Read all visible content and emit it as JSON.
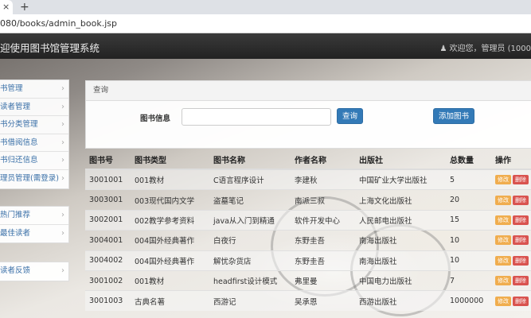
{
  "browser": {
    "tab_close": "×",
    "new_tab": "+",
    "url": "080/books/admin_book.jsp"
  },
  "navbar": {
    "title": "迎使用图书馆管理系统",
    "user_text": "欢迎您，管理员 (1000",
    "user_icon": "user-icon"
  },
  "sidebar": {
    "group1": [
      "书管理",
      "读者管理",
      "书分类管理",
      "书借阅信息",
      "书归还信息",
      "理员管理(需登录)"
    ],
    "group2": [
      "热门推荐",
      "最佳读者"
    ],
    "group3": [
      "读者反馈"
    ],
    "chevron": "›"
  },
  "query": {
    "header": "查询",
    "label": "图书信息",
    "input_value": "",
    "search_button": "查询",
    "add_button": "添加图书"
  },
  "table": {
    "headers": [
      "图书号",
      "图书类型",
      "图书名称",
      "作者名称",
      "出版社",
      "总数量",
      "操作"
    ],
    "edit_label": "修改",
    "delete_label": "删除",
    "rows": [
      [
        "3001001",
        "001教材",
        "C语言程序设计",
        "李建秋",
        "中国矿业大学出版社",
        "5"
      ],
      [
        "3003001",
        "003现代国内文学",
        "盗墓笔记",
        "南派三叔",
        "上海文化出版社",
        "20"
      ],
      [
        "3002001",
        "002教学参考资料",
        "java从入门到精通",
        "软件开发中心",
        "人民邮电出版社",
        "15"
      ],
      [
        "3004001",
        "004国外经典著作",
        "白夜行",
        "东野圭吾",
        "南海出版社",
        "10"
      ],
      [
        "3004002",
        "004国外经典著作",
        "解忧杂货店",
        "东野圭吾",
        "南海出版社",
        "10"
      ],
      [
        "3001002",
        "001教材",
        "headfirst设计模式",
        "弗里曼",
        "中国电力出版社",
        "7"
      ],
      [
        "3001003",
        "古典名著",
        "西游记",
        "吴承恩",
        "西游出版社",
        "1000000"
      ]
    ]
  },
  "colors": {
    "primary": "#337ab7",
    "edit": "#f0ad4e",
    "delete": "#d9534f",
    "navbar": "#2a2a2a",
    "link": "#3a70a8"
  }
}
